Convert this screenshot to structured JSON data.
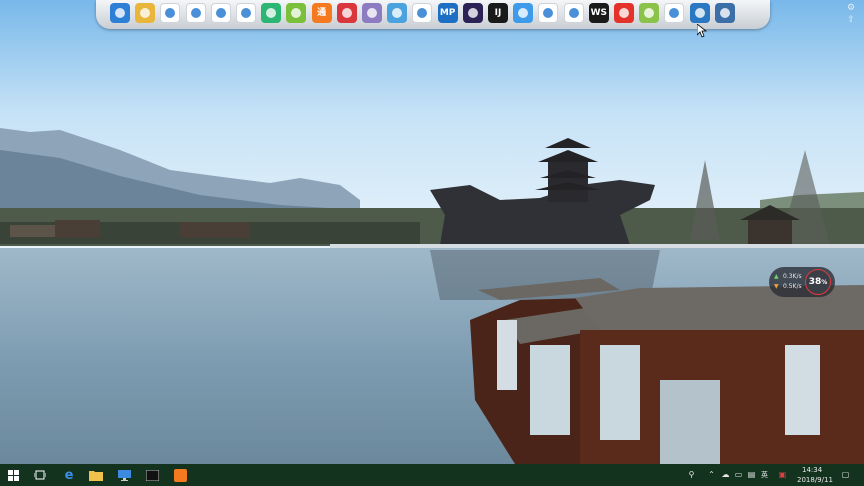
{
  "dock": {
    "icons": [
      {
        "name": "shield-icon",
        "glyph": "",
        "bg": "#2d7fd6"
      },
      {
        "name": "folder-icon",
        "glyph": "",
        "bg": "#e8b63b"
      },
      {
        "name": "chrome-icon",
        "glyph": "",
        "bg": "#ffffff"
      },
      {
        "name": "qq-penguin-icon",
        "glyph": "",
        "bg": "#ffffff"
      },
      {
        "name": "wechat-icon",
        "glyph": "",
        "bg": "#ffffff"
      },
      {
        "name": "weibo-icon",
        "glyph": "",
        "bg": "#ffffff"
      },
      {
        "name": "eye-icon",
        "glyph": "",
        "bg": "#2bb673"
      },
      {
        "name": "tag-icon",
        "glyph": "",
        "bg": "#7bbf3a"
      },
      {
        "name": "app-tong-icon",
        "glyph": "通",
        "bg": "#f57a1f"
      },
      {
        "name": "app-red-square-icon",
        "glyph": "",
        "bg": "#d9363e"
      },
      {
        "name": "dolphin-icon",
        "glyph": "",
        "bg": "#8e7cc3"
      },
      {
        "name": "clipboard-icon",
        "glyph": "",
        "bg": "#4aa3df"
      },
      {
        "name": "painter-icon",
        "glyph": "",
        "bg": "#ffffff"
      },
      {
        "name": "mp-icon",
        "glyph": "MP",
        "bg": "#1d6fc4"
      },
      {
        "name": "eclipse-icon",
        "glyph": "",
        "bg": "#2c2255"
      },
      {
        "name": "intellij-icon",
        "glyph": "IJ",
        "bg": "#1a1a1a"
      },
      {
        "name": "feiyu-icon",
        "glyph": "",
        "bg": "#3d9be9"
      },
      {
        "name": "baidu-cloud-icon",
        "glyph": "",
        "bg": "#ffffff"
      },
      {
        "name": "play-store-icon",
        "glyph": "",
        "bg": "#ffffff"
      },
      {
        "name": "webstorm-icon",
        "glyph": "WS",
        "bg": "#1a1a1a"
      },
      {
        "name": "app-red-logo-icon",
        "glyph": "",
        "bg": "#e4322b"
      },
      {
        "name": "chart-app-icon",
        "glyph": "",
        "bg": "#8bc34a"
      },
      {
        "name": "ie-icon",
        "glyph": "",
        "bg": "#ffffff"
      },
      {
        "name": "monitor-icon",
        "glyph": "",
        "bg": "#2a78c2"
      },
      {
        "name": "settings-app-icon",
        "glyph": "",
        "bg": "#3c6fa8"
      }
    ]
  },
  "netmon": {
    "up": "0.3K/s",
    "down": "0.5K/s",
    "cpu": "38",
    "cpu_unit": "%",
    "colors": {
      "up": "#6fd36f",
      "down": "#f0a040"
    }
  },
  "taskbar": {
    "items": [
      {
        "name": "start-button-icon"
      },
      {
        "name": "task-view-icon"
      },
      {
        "name": "edge-icon"
      },
      {
        "name": "file-explorer-icon"
      },
      {
        "name": "this-pc-icon"
      },
      {
        "name": "terminal-icon"
      },
      {
        "name": "orange-app-icon"
      }
    ],
    "tray": {
      "ime": "英",
      "time": "14:34",
      "date": "2018/9/11"
    }
  }
}
